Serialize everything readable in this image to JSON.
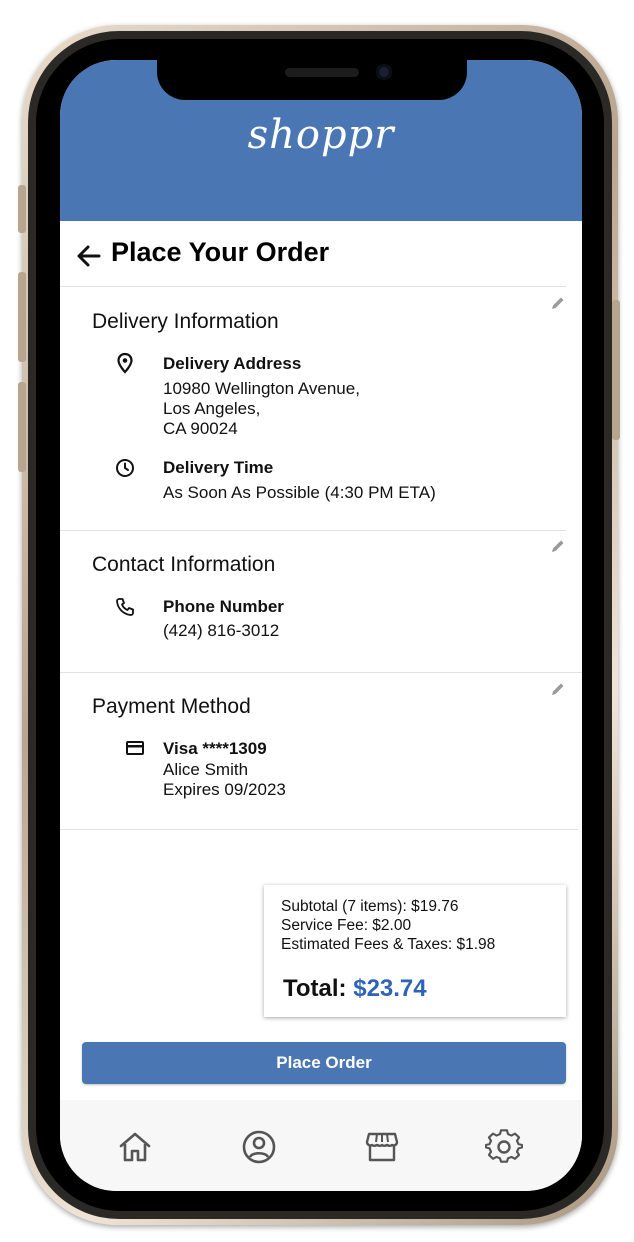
{
  "app": {
    "logo": "shoppr"
  },
  "page": {
    "title": "Place Your Order"
  },
  "delivery": {
    "section_title": "Delivery Information",
    "address_label": "Delivery Address",
    "address_line1": "10980 Wellington Avenue,",
    "address_line2": "Los Angeles,",
    "address_line3": "CA 90024",
    "time_label": "Delivery Time",
    "time_value": "As Soon As Possible (4:30 PM ETA)"
  },
  "contact": {
    "section_title": "Contact Information",
    "phone_label": "Phone Number",
    "phone_value": "(424) 816-3012"
  },
  "payment": {
    "section_title": "Payment Method",
    "card_label": "Visa ****1309",
    "cardholder": "Alice Smith",
    "expiry": "Expires 09/2023"
  },
  "summary": {
    "subtotal": "Subtotal (7 items): $19.76",
    "service_fee": "Service Fee: $2.00",
    "fees_taxes": "Estimated Fees & Taxes: $1.98",
    "total_label": "Total:",
    "total_amount": "$23.74"
  },
  "actions": {
    "place_order": "Place Order"
  },
  "nav": {
    "items": [
      {
        "icon": "home-icon"
      },
      {
        "icon": "profile-icon"
      },
      {
        "icon": "store-icon"
      },
      {
        "icon": "settings-icon"
      }
    ]
  },
  "colors": {
    "brand": "#4a76b4",
    "total_accent": "#2d63b8",
    "frame": "#b7a58f"
  }
}
